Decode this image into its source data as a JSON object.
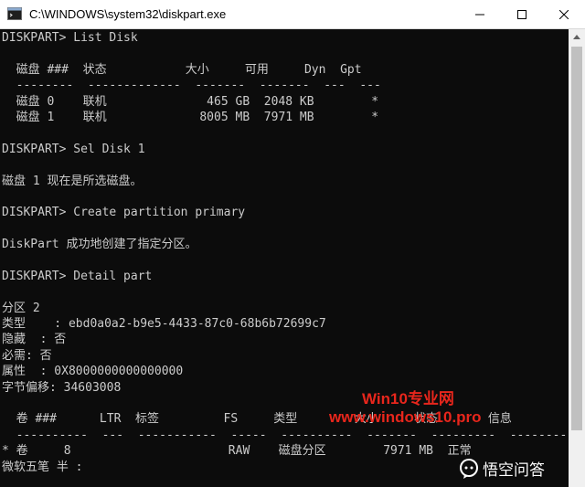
{
  "window": {
    "title": "C:\\WINDOWS\\system32\\diskpart.exe"
  },
  "console": {
    "lines": [
      "DISKPART> List Disk",
      "",
      "  磁盘 ###  状态           大小     可用     Dyn  Gpt",
      "  --------  -------------  -------  -------  ---  ---",
      "  磁盘 0    联机              465 GB  2048 KB        *",
      "  磁盘 1    联机             8005 MB  7971 MB        *",
      "",
      "DISKPART> Sel Disk 1",
      "",
      "磁盘 1 现在是所选磁盘。",
      "",
      "DISKPART> Create partition primary",
      "",
      "DiskPart 成功地创建了指定分区。",
      "",
      "DISKPART> Detail part",
      "",
      "分区 2",
      "类型    : ebd0a0a2-b9e5-4433-87c0-68b6b72699c7",
      "隐藏  : 否",
      "必需: 否",
      "属性  : 0X8000000000000000",
      "字节偏移: 34603008",
      "",
      "  卷 ###      LTR  标签         FS     类型        大小     状态       信息",
      "  ----------  ---  -----------  -----  ----------  -------  ---------  --------",
      "* 卷     8                      RAW    磁盘分区        7971 MB  正常",
      "微软五笔 半 :"
    ]
  },
  "watermarks": {
    "line1": "Win10专业网",
    "line2": "www.windows10.pro",
    "brand": "悟空问答"
  },
  "colors": {
    "console_bg": "#0c0c0c",
    "console_text": "#cccccc",
    "watermark_red": "#e8261c"
  }
}
